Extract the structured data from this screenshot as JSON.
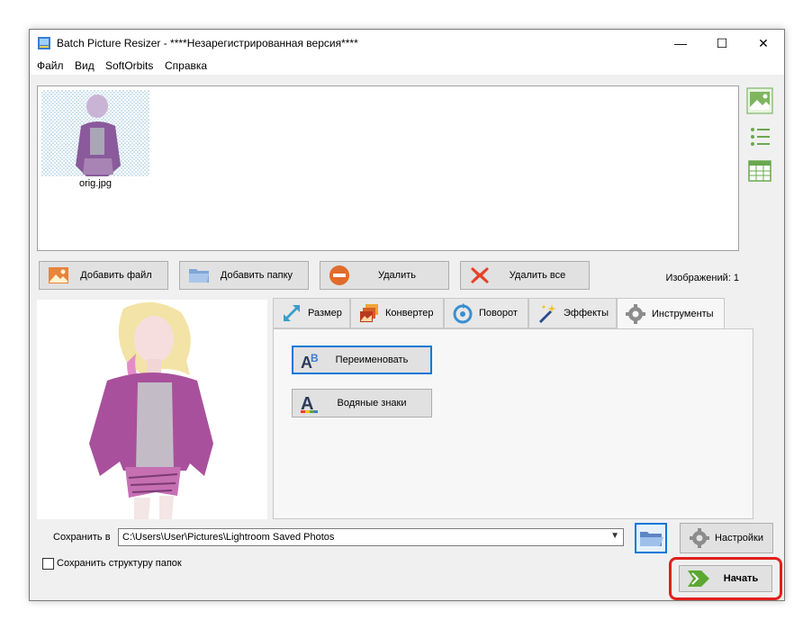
{
  "window": {
    "title": "Batch Picture Resizer - ****Незарегистрированная версия****",
    "minimize": "—",
    "maximize": "☐",
    "close": "✕"
  },
  "menu": [
    "Файл",
    "Вид",
    "SoftOrbits",
    "Справка"
  ],
  "files": [
    {
      "name": "orig.jpg"
    }
  ],
  "side_icons": [
    "thumbnails-view-icon",
    "list-view-icon",
    "table-view-icon"
  ],
  "toolbar": {
    "add_file": "Добавить файл",
    "add_folder": "Добавить папку",
    "remove": "Удалить",
    "remove_all": "Удалить все"
  },
  "image_count": "Изображений: 1",
  "tabs": [
    {
      "label": "Размер",
      "icon": "resize-icon"
    },
    {
      "label": "Конвертер",
      "icon": "convert-icon"
    },
    {
      "label": "Поворот",
      "icon": "rotate-icon"
    },
    {
      "label": "Эффекты",
      "icon": "effects-icon"
    },
    {
      "label": "Инструменты",
      "icon": "tools-gear-icon",
      "active": true
    }
  ],
  "tools": {
    "rename": "Переименовать",
    "watermark": "Водяные знаки"
  },
  "save": {
    "label": "Сохранить в",
    "path": "C:\\Users\\User\\Pictures\\Lightroom Saved Photos",
    "keep_structure": "Сохранить структуру папок",
    "keep_structure_checked": false
  },
  "settings_label": "Настройки",
  "start_label": "Начать",
  "colors": {
    "accent": "#0078d7",
    "highlight": "#e0201b",
    "start_green": "#5aa832"
  }
}
